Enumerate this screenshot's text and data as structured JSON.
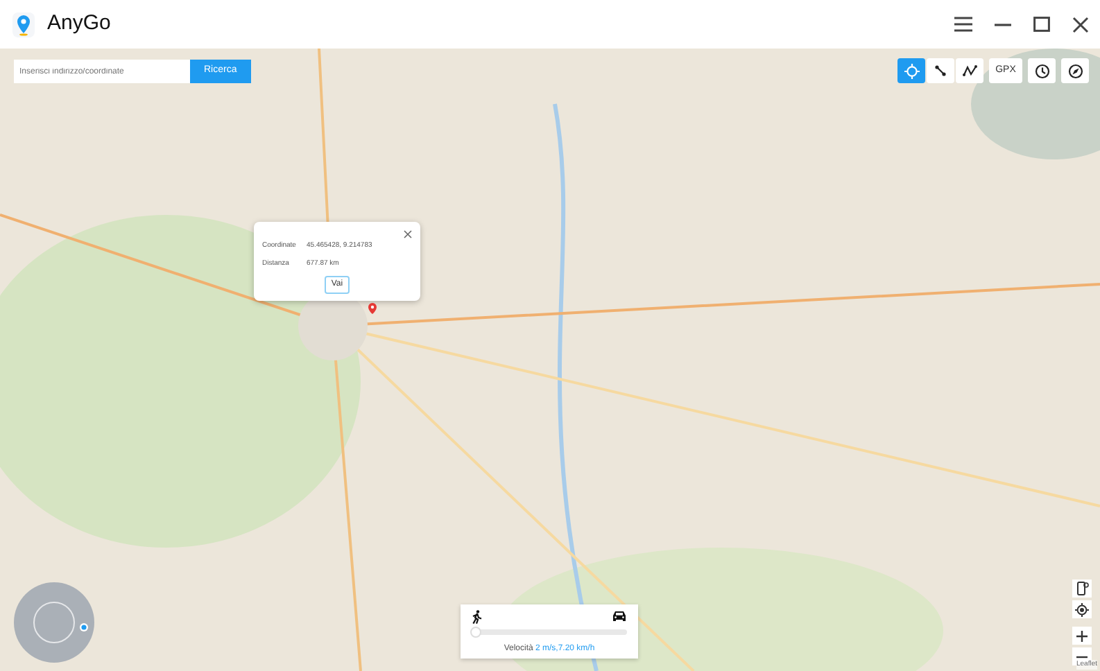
{
  "window": {
    "title": "AnyGo"
  },
  "search": {
    "placeholder": "Inserisci indirizzo/coordinate",
    "button": "Ricerca"
  },
  "mode_buttons": [
    {
      "kind": "teleport",
      "selected": true
    },
    {
      "kind": "two-spot",
      "selected": false
    },
    {
      "kind": "multi-spot",
      "selected": false
    }
  ],
  "tool_buttons": [
    {
      "kind": "gpx",
      "label": "GPX"
    },
    {
      "kind": "history"
    },
    {
      "kind": "compass"
    }
  ],
  "popup": {
    "rows": [
      {
        "label": "Coordinate",
        "value": "45.465428, 9.214783"
      },
      {
        "label": "Distanza",
        "value": "677.87 km"
      }
    ],
    "button": "Vai"
  },
  "speed": {
    "level": 0.03,
    "label": "Velocità",
    "value": "2 m/s,7.20 km/h"
  },
  "attribution": "Leaflet"
}
